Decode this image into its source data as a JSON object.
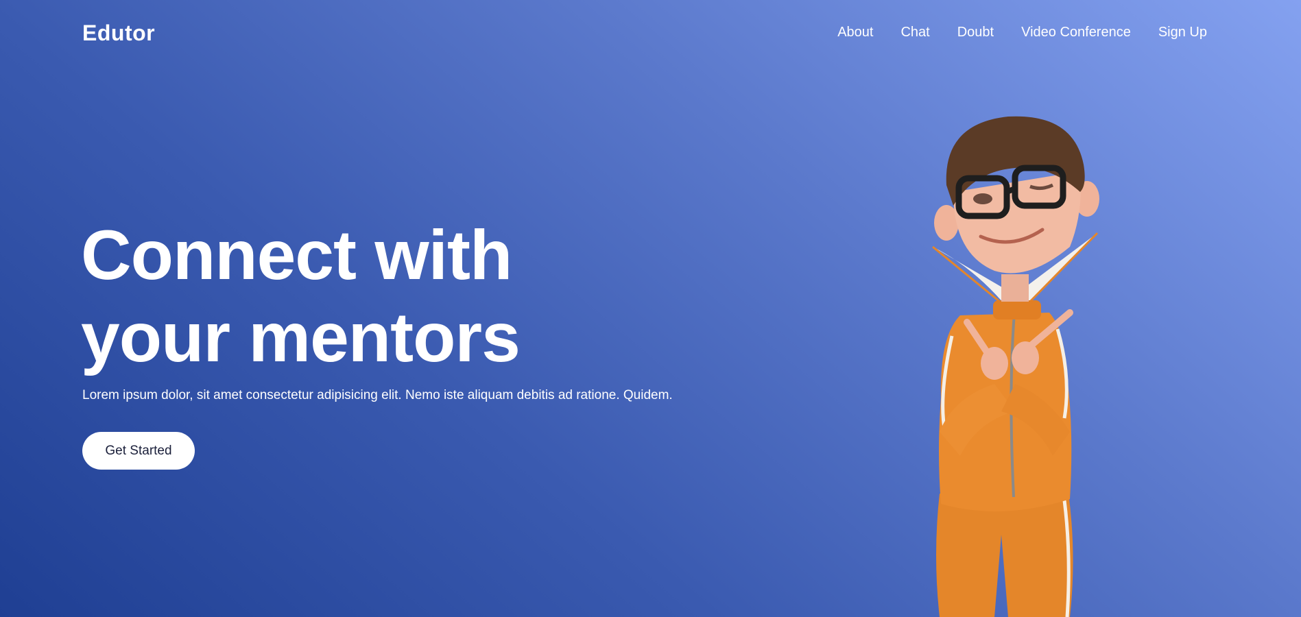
{
  "brand": {
    "name": "Edutor"
  },
  "nav": {
    "items": [
      {
        "label": "About"
      },
      {
        "label": "Chat"
      },
      {
        "label": "Doubt"
      },
      {
        "label": "Video Conference"
      },
      {
        "label": "Sign Up"
      }
    ]
  },
  "hero": {
    "headline_line1": "Connect with",
    "headline_line2": "your mentors",
    "subtext": "Lorem ipsum dolor, sit amet consectetur adipisicing elit. Nemo iste aliquam debitis ad ratione. Quidem.",
    "cta_label": "Get Started"
  },
  "colors": {
    "gradient_start": "#1f3f93",
    "gradient_end": "#84a1f0",
    "cta_background": "#ffffff",
    "cta_text": "#1a1f3a",
    "character_outfit": "#e98a2d"
  },
  "illustration": {
    "icon": "cartoon-boy-character"
  }
}
